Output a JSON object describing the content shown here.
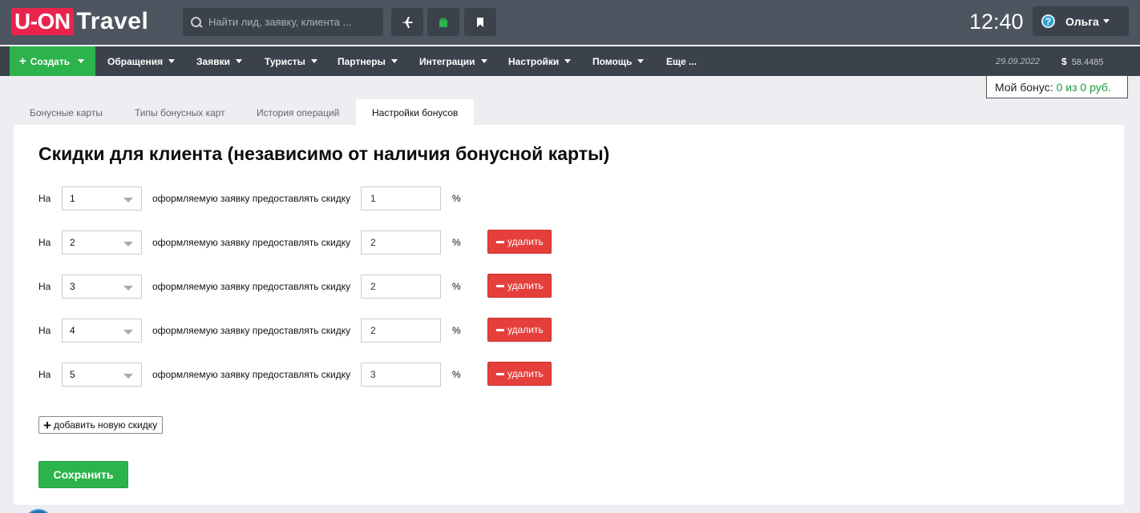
{
  "header": {
    "logo_box": "U-ON",
    "logo_text": "Travel",
    "search_placeholder": "Найти лид, заявку, клиента ...",
    "clock": "12:40",
    "user": "Ольга",
    "help_glyph": "?",
    "tool_icons": [
      "plane-icon",
      "bag-icon",
      "bookmark-icon"
    ]
  },
  "nav": {
    "create": "Создать",
    "items": [
      "Обращения",
      "Заявки",
      "Туристы",
      "Партнеры",
      "Интеграции",
      "Настройки",
      "Помощь",
      "Еще ..."
    ],
    "date": "29.09.2022",
    "currency_symbol": "$",
    "rate": "58.4485"
  },
  "bonus": {
    "label": "Мой бонус:",
    "value": "0 из 0 руб."
  },
  "tabs": [
    "Бонусные карты",
    "Типы бонусных карт",
    "История операций",
    "Настройки бонусов"
  ],
  "active_tab": 3,
  "page": {
    "title": "Скидки для клиента (независимо от наличия бонусной карты)",
    "prefix": "На",
    "row_text": "оформляемую заявку предоставлять скидку",
    "percent": "%",
    "delete_label": "удалить",
    "rows": [
      {
        "order": "1",
        "discount": "1"
      },
      {
        "order": "2",
        "discount": "2"
      },
      {
        "order": "3",
        "discount": "2"
      },
      {
        "order": "4",
        "discount": "2"
      },
      {
        "order": "5",
        "discount": "3"
      }
    ],
    "add_label": "добавить новую скидку",
    "save_label": "Сохранить"
  },
  "colors": {
    "header_bg": "#4d5560",
    "nav_bg": "#3b424b",
    "brand_red": "#e8244c",
    "green": "#2cb34c",
    "danger": "#e53f3c"
  }
}
